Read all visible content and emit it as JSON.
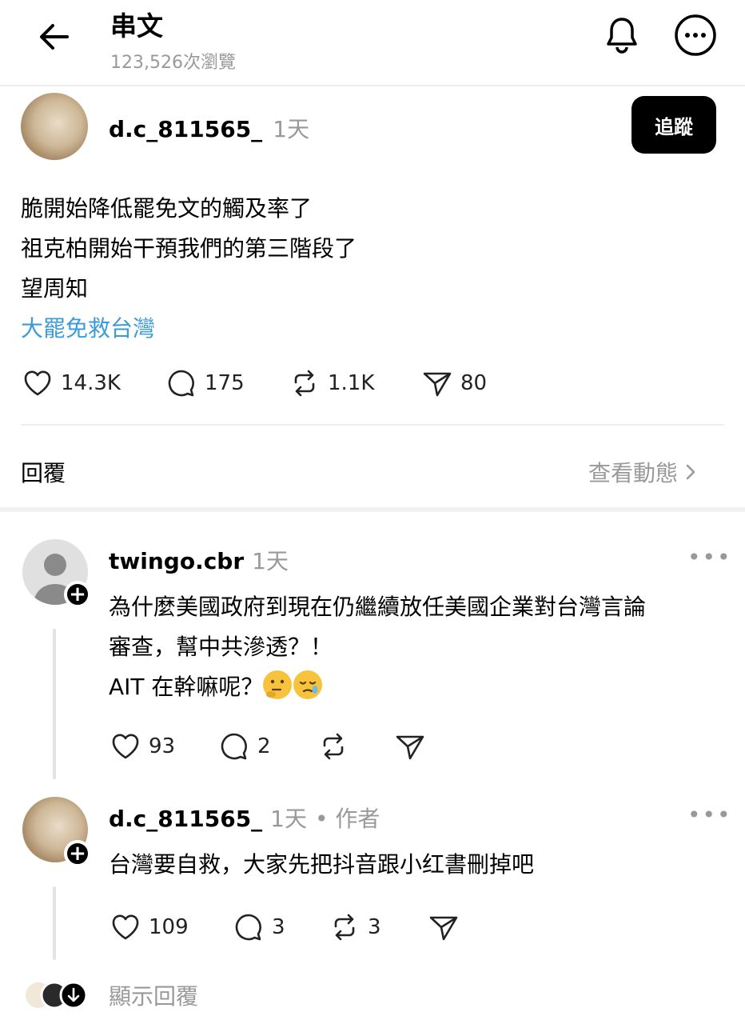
{
  "header": {
    "title": "串文",
    "views": "123,526次瀏覽"
  },
  "post": {
    "username": "d.c_811565_",
    "time": "1天",
    "follow_label": "追蹤",
    "lines": [
      "脆開始降低罷免文的觸及率了",
      "祖克柏開始干預我們的第三階段了",
      "望周知"
    ],
    "hashtag": "大罷免救台灣",
    "stats": {
      "likes": "14.3K",
      "comments": "175",
      "reposts": "1.1K",
      "shares": "80"
    }
  },
  "replies_section": {
    "label": "回覆",
    "view_activity": "查看動態"
  },
  "comments": [
    {
      "username": "twingo.cbr",
      "time": "1天",
      "lines": [
        "為什麼美國政府到現在仍繼續放任美國企業對台灣言論",
        "審查，幫中共滲透？！",
        "AIT 在幹嘛呢？"
      ],
      "emojis": [
        "thinking-face-emoji",
        "sleepy-face-emoji"
      ],
      "likes": "93",
      "comments": "2",
      "reposts": "",
      "more": "•••"
    },
    {
      "username": "d.c_811565_",
      "time": "1天",
      "author_tag": "• 作者",
      "lines": [
        "台灣要自救，大家先把抖音跟小红書刪掉吧"
      ],
      "likes": "109",
      "comments": "3",
      "reposts": "3",
      "more": "•••"
    }
  ],
  "show_replies": "顯示回覆",
  "colors": {
    "hashtag": "#3a9bd9",
    "muted": "#999999",
    "button_bg": "#000000"
  }
}
